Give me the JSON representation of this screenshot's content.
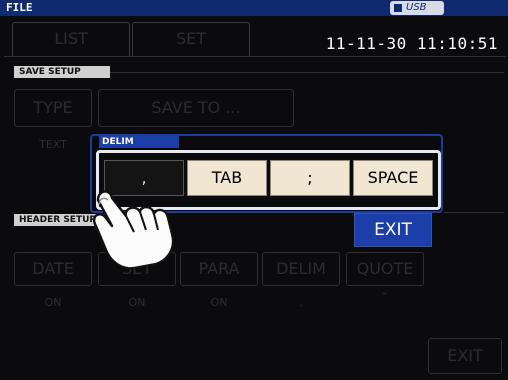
{
  "window": {
    "title": "FILE",
    "usb_label": "USB"
  },
  "tabs": [
    {
      "label": "LIST"
    },
    {
      "label": "SET"
    }
  ],
  "clock": "11-11-30 11:10:51",
  "save_setup": {
    "label": "SAVE SETUP",
    "type_button": "TYPE",
    "type_value": "TEXT",
    "save_to_button": "SAVE TO ..."
  },
  "header_setup": {
    "label": "HEADER SETUP",
    "buttons": [
      {
        "label": "DATE",
        "value": "ON"
      },
      {
        "label": "SET",
        "value": "ON"
      },
      {
        "label": "PARA",
        "value": "ON"
      },
      {
        "label": "DELIM",
        "value": ","
      },
      {
        "label": "QUOTE",
        "value": "\""
      }
    ]
  },
  "delim_dialog": {
    "title": "DELIM",
    "options": [
      ",",
      "TAB",
      ";",
      "SPACE"
    ],
    "selected_index": 0,
    "exit_label": "EXIT"
  },
  "footer": {
    "exit_label": "EXIT"
  },
  "colors": {
    "title_bar": "#0f2a6e",
    "accent_blue": "#1b3ea8",
    "option_bg": "#f0e6d2",
    "screen_bg": "#0b0b0d"
  },
  "icons": {
    "pointer": "hand-pointer-icon",
    "memory": "memory-icon"
  }
}
